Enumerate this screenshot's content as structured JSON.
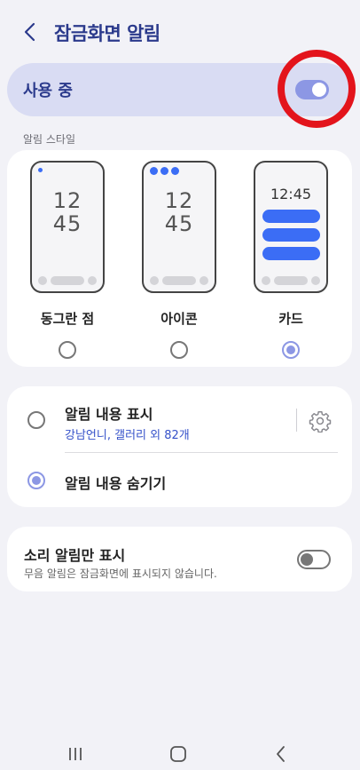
{
  "header": {
    "title": "잠금화면 알림",
    "back_icon": "chevron-left-icon"
  },
  "master": {
    "label": "사용 중",
    "toggle_on": true,
    "accent_color": "#8c97e4",
    "annotation_color": "#e3141c"
  },
  "style_section": {
    "label": "알림 스타일",
    "options": [
      {
        "label": "동그란 점",
        "preview_clock": [
          "12",
          "45"
        ],
        "selected": false
      },
      {
        "label": "아이콘",
        "preview_clock": [
          "12",
          "45"
        ],
        "selected": false
      },
      {
        "label": "카드",
        "preview_clock": [
          "12:45"
        ],
        "selected": true
      }
    ]
  },
  "content_section": {
    "show_content": {
      "label": "알림 내용 표시",
      "subtitle": "강남언니, 갤러리 외 82개",
      "selected": false,
      "settings_icon": "gear-icon"
    },
    "hide_content": {
      "label": "알림 내용 숨기기",
      "selected": true
    }
  },
  "sound_section": {
    "title": "소리 알림만 표시",
    "description": "무음 알림은 잠금화면에 표시되지 않습니다.",
    "toggle_on": false
  },
  "navbar": {
    "icons": [
      "recent-apps-icon",
      "home-icon",
      "back-icon"
    ]
  },
  "colors": {
    "background": "#f2f2f7",
    "title_blue": "#2b3a8c",
    "link_blue": "#3551c9",
    "preview_blue": "#3b6df5"
  }
}
